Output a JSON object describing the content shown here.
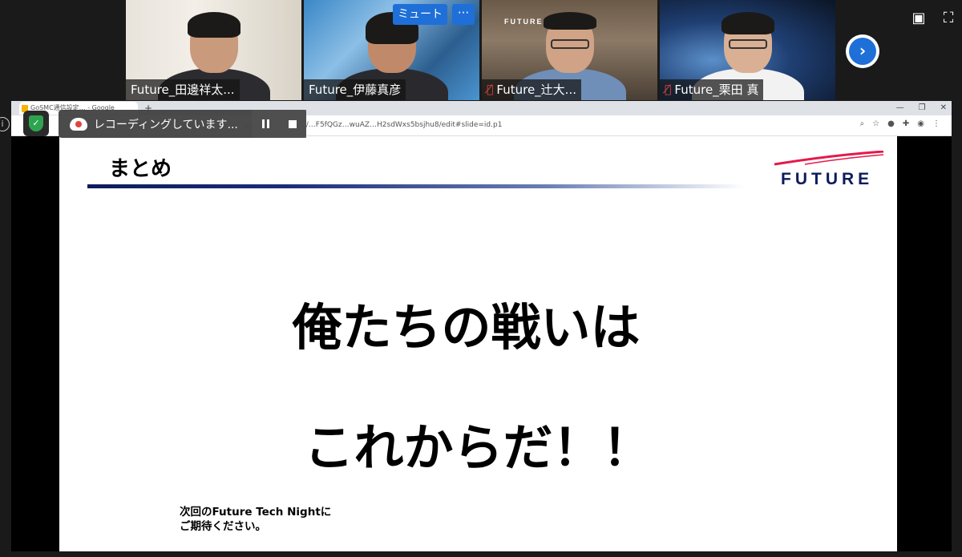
{
  "participants": [
    {
      "name": "Future_田邊祥太...",
      "muted": false
    },
    {
      "name": "Future_伊藤真彦",
      "muted": false,
      "active": true
    },
    {
      "name": "Future_辻大...",
      "muted": true
    },
    {
      "name": "Future_栗田 真",
      "muted": true
    }
  ],
  "tile_controls": {
    "mute_label": "ミュート",
    "more_label": "···"
  },
  "tile_background_text": "FUTURE",
  "recording": {
    "label": "レコーディングしています..."
  },
  "browser": {
    "tab_title": "GoSMC通信設定… - Google",
    "url": "…/presentation/d/…F5fQGz…wuAZ…H2sdWxs5bsjhu8/edit#slide=id.p1"
  },
  "slide": {
    "title": "まとめ",
    "logo": "FUTURE",
    "line1": "俺たちの戦いは",
    "line2": "これからだ！！",
    "footnote_line1": "次回のFuture Tech Nightに",
    "footnote_line2": "ご期待ください。"
  },
  "colors": {
    "accent_blue": "#1f6fd8",
    "active_border": "#8fd45b",
    "logo_navy": "#0d1b5c",
    "logo_red": "#e4194b",
    "record_red": "#e0463c"
  },
  "icons": [
    "shield-icon",
    "cloud-record-icon",
    "pause-icon",
    "stop-icon",
    "next-page-icon",
    "view-icon",
    "fullscreen-icon",
    "mic-off-icon"
  ]
}
